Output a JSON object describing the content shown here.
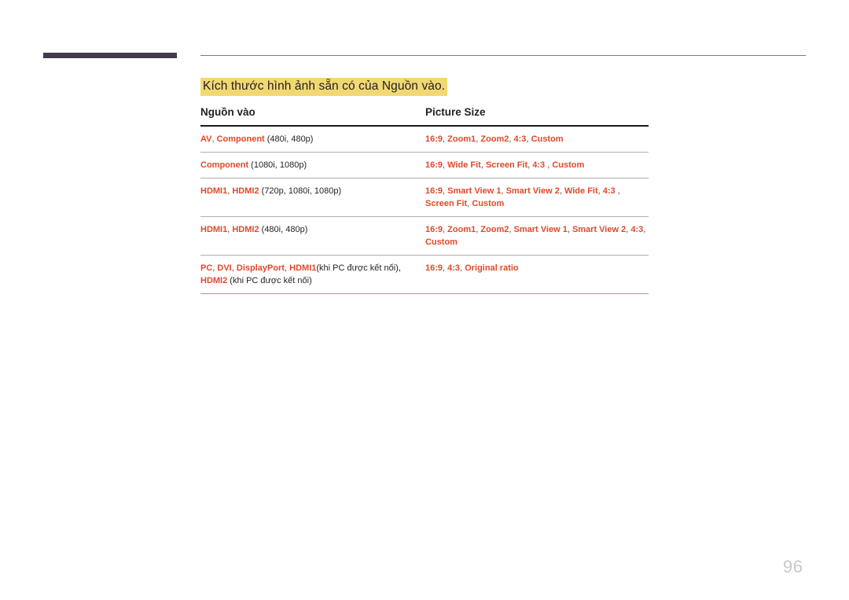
{
  "page": {
    "number": "96",
    "section_title": "Kích thước hình ảnh sẵn có của Nguồn vào.",
    "highlight_color": "#f2d873",
    "accent_color": "#e0492a",
    "deco_bar_color": "#443a4e",
    "bottom_rule_color": "#bf8f96"
  },
  "table": {
    "headers": {
      "source": "Nguồn vào",
      "picture_size": "Picture Size"
    },
    "rows": [
      {
        "source_html": "<span class=\"hl\">AV</span><span class=\"sep\">, </span><span class=\"hl\">Component</span> (480i, 480p)",
        "size_html": "<span class=\"hl\">16:9</span><span class=\"sep\">, </span><span class=\"hl\">Zoom1</span><span class=\"sep\">, </span><span class=\"hl\">Zoom2</span><span class=\"sep\">, </span><span class=\"hl\">4:3</span><span class=\"sep\">, </span><span class=\"hl\">Custom</span>",
        "source_plain": "AV, Component (480i, 480p)",
        "size_plain": "16:9, Zoom1, Zoom2, 4:3, Custom"
      },
      {
        "source_html": "<span class=\"hl\">Component</span> (1080i, 1080p)",
        "size_html": "<span class=\"hl\">16:9</span><span class=\"sep\">, </span><span class=\"hl\">Wide Fit</span><span class=\"sep\">, </span><span class=\"hl\">Screen Fit</span><span class=\"sep\">, </span><span class=\"hl\">4:3</span><span class=\"sep\"> , </span><span class=\"hl\">Custom</span>",
        "source_plain": "Component (1080i, 1080p)",
        "size_plain": "16:9, Wide Fit, Screen Fit, 4:3 , Custom"
      },
      {
        "source_html": "<span class=\"hl\">HDMI1</span><span class=\"sep\">, </span><span class=\"hl\">HDMI2</span> (720p, 1080i, 1080p)",
        "size_html": "<span class=\"hl\">16:9</span><span class=\"sep\">, </span><span class=\"hl\">Smart View 1</span><span class=\"sep\">, </span><span class=\"hl\">Smart View 2</span><span class=\"sep\">, </span><span class=\"hl\">Wide Fit</span><span class=\"sep\">, </span><span class=\"hl\">4:3</span><span class=\"sep\"> ,</span><br><span class=\"hl\">Screen Fit</span><span class=\"sep\">, </span><span class=\"hl\">Custom</span>",
        "source_plain": "HDMI1, HDMI2 (720p, 1080i, 1080p)",
        "size_plain": "16:9, Smart View 1, Smart View 2, Wide Fit, 4:3 , Screen Fit, Custom"
      },
      {
        "source_html": "<span class=\"hl\">HDMI1</span><span class=\"sep\">, </span><span class=\"hl\">HDMI2</span> (480i, 480p)",
        "size_html": "<span class=\"hl\">16:9</span><span class=\"sep\">, </span><span class=\"hl\">Zoom1</span><span class=\"sep\">, </span><span class=\"hl\">Zoom2</span><span class=\"sep\">, </span><span class=\"hl\">Smart View 1</span><span class=\"sep\">, </span><span class=\"hl\">Smart View 2</span><span class=\"sep\">, </span><span class=\"hl\">4:3</span><span class=\"sep\">,</span><br><span class=\"hl\">Custom</span>",
        "source_plain": "HDMI1, HDMI2 (480i, 480p)",
        "size_plain": "16:9, Zoom1, Zoom2, Smart View 1, Smart View 2, 4:3, Custom"
      },
      {
        "source_html": "<span class=\"hl\">PC</span><span class=\"sep\">, </span><span class=\"hl\">DVI</span><span class=\"sep\">, </span><span class=\"hl\">DisplayPort</span><span class=\"sep\">, </span><span class=\"hl\">HDMI1</span>(khi PC được kết nối),<br><span class=\"hl\">HDMI2</span> (khi PC được kết nối)",
        "size_html": "<span class=\"hl\">16:9</span><span class=\"sep\">, </span><span class=\"hl\">4:3</span><span class=\"sep\">, </span><span class=\"hl\">Original ratio</span>",
        "source_plain": "PC, DVI, DisplayPort, HDMI1(khi PC được kết nối), HDMI2 (khi PC được kết nối)",
        "size_plain": "16:9, 4:3, Original ratio"
      }
    ]
  }
}
